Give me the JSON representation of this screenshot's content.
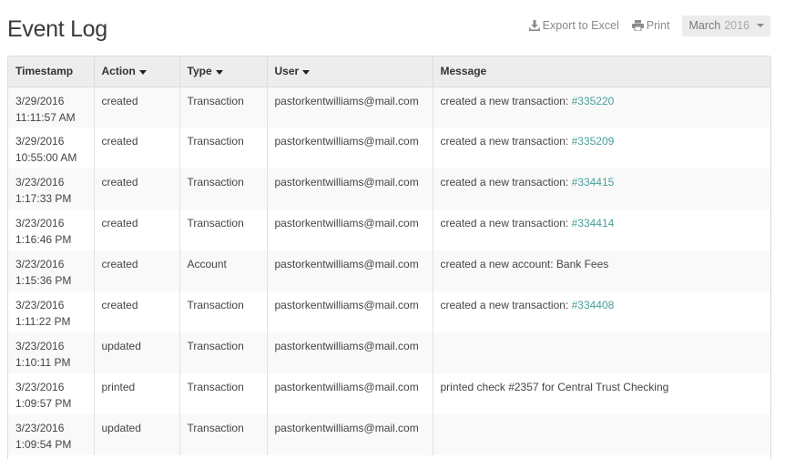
{
  "page": {
    "title": "Event Log"
  },
  "toolbar": {
    "export_label": "Export to Excel",
    "export_icon": "download-icon",
    "print_label": "Print",
    "print_icon": "printer-icon",
    "month": "March",
    "year": "2016"
  },
  "table": {
    "headers": {
      "timestamp": "Timestamp",
      "action": "Action",
      "type": "Type",
      "user": "User",
      "message": "Message"
    },
    "rows": [
      {
        "date": "3/29/2016",
        "time": "11:11:57 AM",
        "action": "created",
        "type": "Transaction",
        "user": "pastorkentwilliams@mail.com",
        "message": "created a new transaction: ",
        "link": "#335220"
      },
      {
        "date": "3/29/2016",
        "time": "10:55:00 AM",
        "action": "created",
        "type": "Transaction",
        "user": "pastorkentwilliams@mail.com",
        "message": "created a new transaction: ",
        "link": "#335209"
      },
      {
        "date": "3/23/2016",
        "time": "1:17:33 PM",
        "action": "created",
        "type": "Transaction",
        "user": "pastorkentwilliams@mail.com",
        "message": "created a new transaction: ",
        "link": "#334415"
      },
      {
        "date": "3/23/2016",
        "time": "1:16:46 PM",
        "action": "created",
        "type": "Transaction",
        "user": "pastorkentwilliams@mail.com",
        "message": "created a new transaction: ",
        "link": "#334414"
      },
      {
        "date": "3/23/2016",
        "time": "1:15:36 PM",
        "action": "created",
        "type": "Account",
        "user": "pastorkentwilliams@mail.com",
        "message": "created a new account: Bank Fees",
        "link": ""
      },
      {
        "date": "3/23/2016",
        "time": "1:11:22 PM",
        "action": "created",
        "type": "Transaction",
        "user": "pastorkentwilliams@mail.com",
        "message": "created a new transaction: ",
        "link": "#334408"
      },
      {
        "date": "3/23/2016",
        "time": "1:10:11 PM",
        "action": "updated",
        "type": "Transaction",
        "user": "pastorkentwilliams@mail.com",
        "message": "",
        "link": ""
      },
      {
        "date": "3/23/2016",
        "time": "1:09:57 PM",
        "action": "printed",
        "type": "Transaction",
        "user": "pastorkentwilliams@mail.com",
        "message": "printed check #2357 for Central Trust Checking",
        "link": ""
      },
      {
        "date": "3/23/2016",
        "time": "1:09:54 PM",
        "action": "updated",
        "type": "Transaction",
        "user": "pastorkentwilliams@mail.com",
        "message": "",
        "link": ""
      }
    ]
  },
  "colors": {
    "link": "#4a9f9b",
    "header_bg": "#ededed",
    "row_alt": "#f9f9f9"
  }
}
